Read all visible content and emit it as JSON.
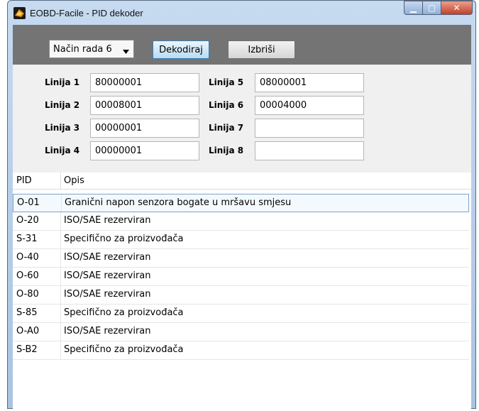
{
  "window": {
    "title": "EOBD-Facile - PID dekoder",
    "colors": {
      "titlebar": "#b7cde8",
      "toolbar": "#747474",
      "close": "#c2402a"
    }
  },
  "toolbar": {
    "mode_value": "Način rada 6",
    "decode_label": "Dekodiraj",
    "clear_label": "Izbriši"
  },
  "lines": {
    "line1": {
      "label": "Linija 1",
      "value": "80000001"
    },
    "line2": {
      "label": "Linija 2",
      "value": "00008001"
    },
    "line3": {
      "label": "Linija 3",
      "value": "00000001"
    },
    "line4": {
      "label": "Linija 4",
      "value": "00000001"
    },
    "line5": {
      "label": "Linija 5",
      "value": "08000001"
    },
    "line6": {
      "label": "Linija 6",
      "value": "00004000"
    },
    "line7": {
      "label": "Linija 7",
      "value": ""
    },
    "line8": {
      "label": "Linija 8",
      "value": ""
    }
  },
  "table": {
    "columns": [
      "PID",
      "Opis"
    ],
    "rows": [
      {
        "pid": "O-01",
        "desc": "Granični napon senzora bogate u mršavu smjesu"
      },
      {
        "pid": "O-20",
        "desc": "ISO/SAE rezerviran"
      },
      {
        "pid": "S-31",
        "desc": "Specifično za proizvođača"
      },
      {
        "pid": "O-40",
        "desc": "ISO/SAE rezerviran"
      },
      {
        "pid": "O-60",
        "desc": "ISO/SAE rezerviran"
      },
      {
        "pid": "O-80",
        "desc": "ISO/SAE rezerviran"
      },
      {
        "pid": "S-85",
        "desc": "Specifično za proizvođača"
      },
      {
        "pid": "O-A0",
        "desc": "ISO/SAE rezerviran"
      },
      {
        "pid": "S-B2",
        "desc": "Specifično za proizvođača"
      }
    ]
  },
  "icons": [
    "app-icon",
    "minimize-icon",
    "maximize-icon",
    "close-icon",
    "chevron-down-icon"
  ]
}
